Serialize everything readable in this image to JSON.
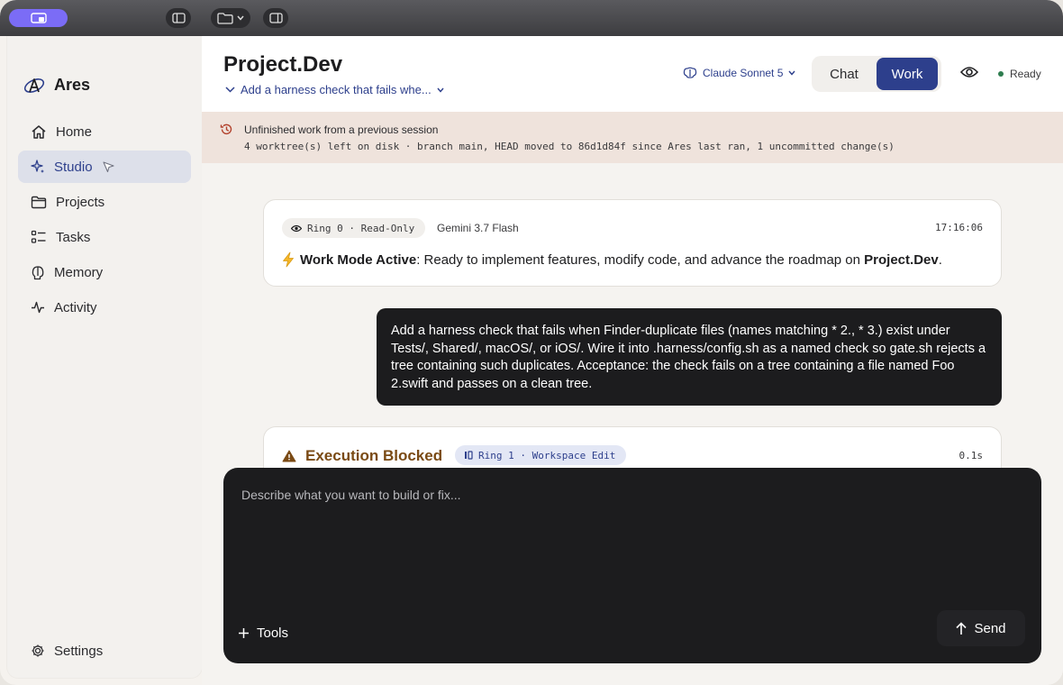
{
  "app": {
    "name": "Ares"
  },
  "sidebar": {
    "items": [
      {
        "label": "Home",
        "icon": "home-icon"
      },
      {
        "label": "Studio",
        "icon": "sparkle-icon",
        "active": true
      },
      {
        "label": "Projects",
        "icon": "folder-icon"
      },
      {
        "label": "Tasks",
        "icon": "tasks-icon"
      },
      {
        "label": "Memory",
        "icon": "brain-icon"
      },
      {
        "label": "Activity",
        "icon": "activity-icon"
      }
    ],
    "settings_label": "Settings"
  },
  "header": {
    "title": "Project.Dev",
    "subtitle": "Add a harness check that fails whe...",
    "model": "Claude Sonnet 5",
    "modes": {
      "chat": "Chat",
      "work": "Work",
      "active": "Work"
    },
    "status": "Ready"
  },
  "banner": {
    "title": "Unfinished work from a previous session",
    "detail": "4 worktree(s) left on disk · branch main, HEAD moved to 86d1d84f since Ares last ran, 1 uncommitted change(s)"
  },
  "messages": {
    "system": {
      "ring": "Ring 0 · Read-Only",
      "model": "Gemini 3.7 Flash",
      "time": "17:16:06",
      "prefix": "Work Mode Active",
      "body_a": ": Ready to implement features, modify code, and advance the roadmap on ",
      "project": "Project.Dev",
      "body_b": "."
    },
    "user": "Add a harness check that fails when Finder-duplicate files (names matching * 2., * 3.) exist under Tests/, Shared/, macOS/, or iOS/. Wire it into .harness/config.sh as a named check so gate.sh rejects a tree containing such duplicates. Acceptance: the check fails on a tree containing a file named Foo 2.swift and passes on a clean tree.",
    "blocked": {
      "title": "Execution Blocked",
      "ring": "Ring 1 · Workspace Edit",
      "duration": "0.1s"
    }
  },
  "composer": {
    "placeholder": "Describe what you want to build or fix...",
    "tools_label": "Tools",
    "send_label": "Send"
  },
  "colors": {
    "accent": "#2d3f8c",
    "status_ready": "#2e7d4f",
    "warning": "#7a4a14",
    "banner_bg": "#efe3dc"
  }
}
